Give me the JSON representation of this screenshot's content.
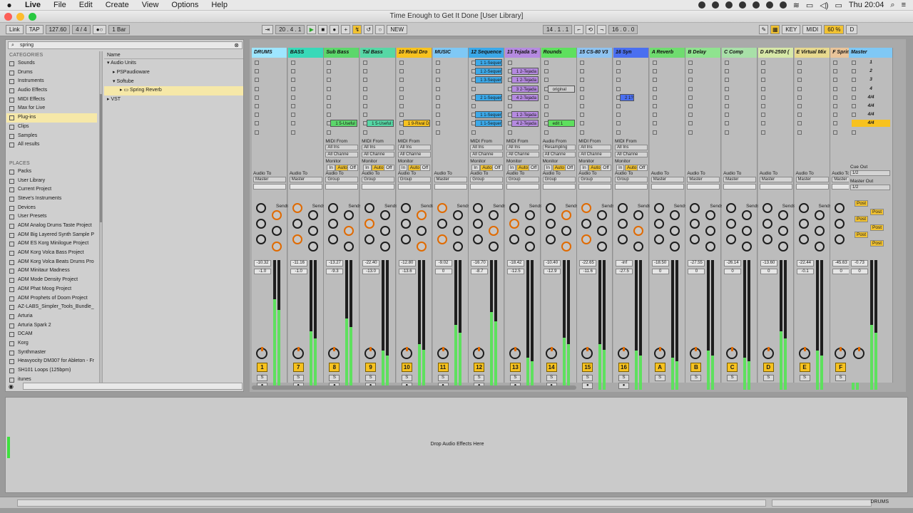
{
  "menubar": {
    "apple": "",
    "items": [
      "Live",
      "File",
      "Edit",
      "Create",
      "View",
      "Options",
      "Help"
    ],
    "clock": "Thu 20:04"
  },
  "window": {
    "title": "Time Enough to Get It Done  [User Library]"
  },
  "controlbar": {
    "link": "Link",
    "tap": "TAP",
    "tempo": "127.60",
    "signature": "4 / 4",
    "metro": "1 Bar",
    "position": "20 .   4 .   1",
    "new": "NEW",
    "loop_start": "14 .   1 .   1",
    "loop_length": "16 .   0 .   0",
    "key": "KEY",
    "midi": "MIDI",
    "cpu": "60 %",
    "d": "D"
  },
  "browser": {
    "search": "spring",
    "categories_title": "CATEGORIES",
    "categories": [
      "Sounds",
      "Drums",
      "Instruments",
      "Audio Effects",
      "MIDI Effects",
      "Max for Live",
      "Plug-ins",
      "Clips",
      "Samples",
      "All results"
    ],
    "places_title": "PLACES",
    "places": [
      "Packs",
      "User Library",
      "Current Project",
      "Steve's Instruments",
      "Devices",
      "User Presets",
      "ADM Analog Drums Taste Project",
      "ADM Big Layered Synth Sample P",
      "ADM ES Korg Minilogue Project",
      "ADM Korg Volca Bass Project",
      "ADM Korg Volca Beats Drums Pro",
      "ADM Minitaur Madness",
      "ADM Mode Density Project",
      "ADM Phat Moog  Project",
      "ADM Prophets of Doom Project",
      "AZ-LABS_Simpler_Tools_Bundle_",
      "Arturia",
      "Arturia Spark 2",
      "DCAM",
      "Korg",
      "Synthmaster",
      "Heavyocity DM307 for Ableton - Fr",
      "SH101 Loops (125bpm)",
      "itunes"
    ],
    "files_header": "Name",
    "files": [
      "Audio Units",
      "PSPaudioware",
      "Softube",
      "Spring Reverb",
      "VST"
    ]
  },
  "tracks": [
    {
      "name": "DRUMS",
      "color": "#9ee6ff",
      "num": "1",
      "vol": "-10.32",
      "pan": "-1.0",
      "io_to": "Master"
    },
    {
      "name": "BASS",
      "color": "#38d9b8",
      "num": "7",
      "vol": "-11.16",
      "pan": "-1.0",
      "io_to": "Master"
    },
    {
      "name": "Sub Bass",
      "color": "#5cd76b",
      "num": "8",
      "vol": "-13.27",
      "pan": "-9.3",
      "io_to": "Group"
    },
    {
      "name": "Tal Bass",
      "color": "#56d7a5",
      "num": "9",
      "vol": "-22.40",
      "pan": "-13.0",
      "io_to": "Group"
    },
    {
      "name": "10 Rival Dro",
      "color": "#f7c21f",
      "num": "10",
      "vol": "-12.80",
      "pan": "-13.6",
      "io_to": "Group"
    },
    {
      "name": "MUSIC",
      "color": "#7fc8f5",
      "num": "11",
      "vol": "-9.02",
      "pan": "0",
      "io_to": "Master"
    },
    {
      "name": "12 Sequence",
      "color": "#3ba8e8",
      "num": "12",
      "vol": "-16.70",
      "pan": "-8.7",
      "io_to": "Group"
    },
    {
      "name": "13 Tejada Se",
      "color": "#b58ae0",
      "num": "13",
      "vol": "-18.42",
      "pan": "-12.5",
      "io_to": "Group"
    },
    {
      "name": "Rounds",
      "color": "#5ee05e",
      "num": "14",
      "vol": "-10.40",
      "pan": "-12.9",
      "io_to": "Group"
    },
    {
      "name": "15 CS-80 V3",
      "color": "#8fc3f0",
      "num": "15",
      "vol": "-22.65",
      "pan": "-11.6",
      "io_to": "Group"
    },
    {
      "name": "16 Syn",
      "color": "#4a6ff0",
      "num": "16",
      "vol": "-inf",
      "pan": "-27.5",
      "io_to": "Group"
    },
    {
      "name": "A Reverb",
      "color": "#6fdc6f",
      "num": "A",
      "vol": "-18.50",
      "pan": "0",
      "io_to": "Master"
    },
    {
      "name": "B Delay",
      "color": "#8fe38f",
      "num": "B",
      "vol": "-27.55",
      "pan": "0",
      "io_to": "Master"
    },
    {
      "name": "C Comp",
      "color": "#a8e0a8",
      "num": "C",
      "vol": "-26.14",
      "pan": "0",
      "io_to": "Master"
    },
    {
      "name": "D API-2500 (",
      "color": "#d7e8a8",
      "num": "D",
      "vol": "-13.60",
      "pan": "0",
      "io_to": "Master"
    },
    {
      "name": "E Virtual Mix",
      "color": "#e7d98f",
      "num": "E",
      "vol": "-22.44",
      "pan": "-0.1",
      "io_to": "Master"
    },
    {
      "name": "F Spring Re",
      "color": "#e9c49a",
      "num": "F",
      "vol": "-45.63",
      "pan": "0",
      "io_to": "Master"
    },
    {
      "name": "Master",
      "color": "#7fc8f5",
      "num": "",
      "vol": "-0.73",
      "pan": "0",
      "io_to": ""
    }
  ],
  "labels": {
    "sends": "Sends",
    "audio_to": "Audio To",
    "midi_from": "MIDI From",
    "audio_from": "Audio From",
    "all_ins": "All Ins",
    "all_channels": "All Channe",
    "monitor": "Monitor",
    "in": "In",
    "auto": "Auto",
    "off": "Off",
    "resampling": "Resampling",
    "cue_out": "Cue Out",
    "master_out": "Master Out",
    "cue_val": "1/2",
    "master_val": "1/2",
    "post": "Post",
    "drop": "Drop Audio Effects Here",
    "status_track": "DRUMS"
  },
  "clips": {
    "useful1": "1 5-Useful S",
    "useful2": "1 5-Useful S",
    "rival": "1 9-Rival Dr",
    "seq1": "1 1-Sequen",
    "seq2": "1 2-Sequen",
    "seq3": "1 3-Sequen",
    "seq4": "2 1-Sequen",
    "tejada1": "1 2-Tejada S",
    "tejada2": "1 2-Tejada S",
    "tejada3": "3 2-Tejada S",
    "tejada4": "4 2-Tejada S",
    "tejada5": "1 2-Tejada S",
    "tejada6": "4 2-Tejada S",
    "original": "original",
    "edit1": "edit 1",
    "syn": "2 1?"
  },
  "scenes": [
    "1",
    "2",
    "3",
    "4",
    "4/4",
    "4/4",
    "4/4",
    "4/4"
  ]
}
